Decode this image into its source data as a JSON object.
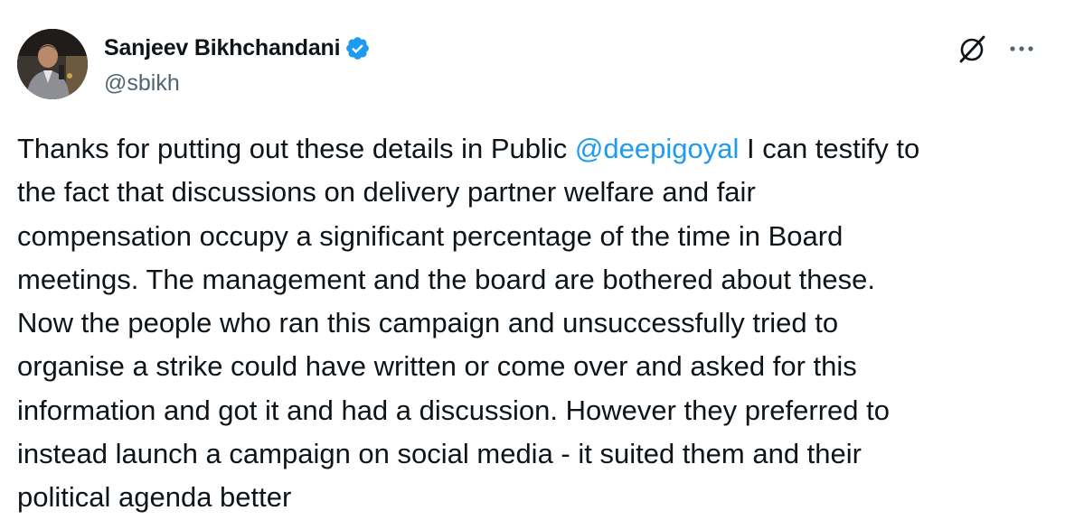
{
  "author": {
    "display_name": "Sanjeev Bikhchandani",
    "handle": "@sbikh",
    "verified": true,
    "verified_badge_color": "#1d9bf0"
  },
  "actions": {
    "grok_icon": "grok-icon",
    "more_icon": "more-horizontal-icon"
  },
  "tweet": {
    "line1_before": "Thanks for putting out these details in Public ",
    "mention": "@deepigoyal",
    "line1_after": " I can testify to",
    "line2": "the fact that discussions on delivery partner welfare and fair",
    "line3": "compensation occupy a significant percentage of the time in Board",
    "line4": "meetings. The management and the board are bothered about these.",
    "line5": "Now the people who ran this campaign and unsuccessfully tried to",
    "line6": "organise a strike could have written or come over and asked for this",
    "line7": "information and got it and had a discussion. However they preferred to",
    "line8": "instead launch a campaign on social media - it suited them and their",
    "line9": "political agenda better"
  },
  "colors": {
    "text": "#0f1419",
    "secondary_text": "#536471",
    "link": "#1d9bf0"
  }
}
